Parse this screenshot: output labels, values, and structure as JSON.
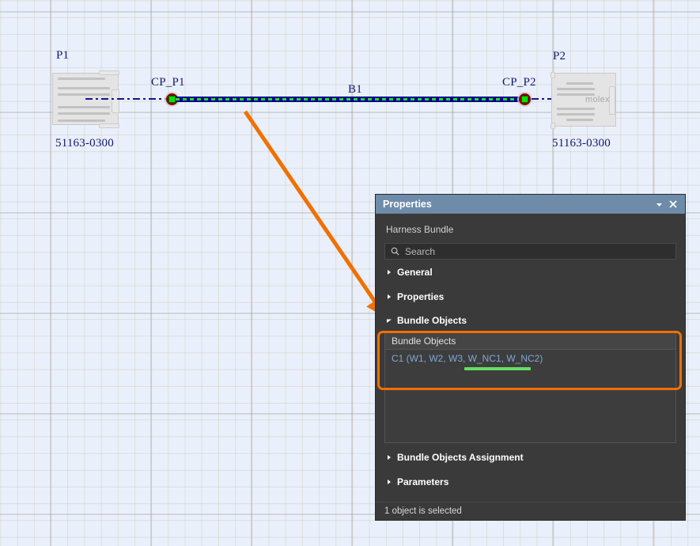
{
  "canvas": {
    "connectors": [
      {
        "id": "p1",
        "ref_label": "P1",
        "part_number": "51163-0300",
        "brand": "",
        "cp_label": "CP_P1"
      },
      {
        "id": "p2",
        "ref_label": "P2",
        "part_number": "51163-0300",
        "brand": "molex",
        "cp_label": "CP_P2"
      }
    ],
    "bundle": {
      "label": "B1",
      "core_color": "#00008f",
      "dash_color": "#1fe01f"
    },
    "node_colors": {
      "ring": "#8b0000",
      "square": "#00e400"
    },
    "annotation": {
      "type": "arrow",
      "color": "#f07000"
    }
  },
  "panel": {
    "title": "Properties",
    "subtitle": "Harness Bundle",
    "titlebar_buttons": [
      {
        "name": "menu-dropdown",
        "glyph": "triangle-down"
      },
      {
        "name": "close",
        "glyph": "x"
      }
    ],
    "search": {
      "icon": "search-icon",
      "placeholder": "Search",
      "value": ""
    },
    "sections": [
      {
        "key": "general",
        "label": "General",
        "expanded": false
      },
      {
        "key": "properties",
        "label": "Properties",
        "expanded": false
      },
      {
        "key": "bundle_objects",
        "label": "Bundle Objects",
        "expanded": true,
        "highlighted": true
      },
      {
        "key": "bundle_objects_assignment",
        "label": "Bundle Objects Assignment",
        "expanded": false
      },
      {
        "key": "parameters",
        "label": "Parameters",
        "expanded": false
      }
    ],
    "bundle_objects": {
      "column_header": "Bundle Objects",
      "rows": [
        {
          "label": "C1 (W1, W2, W3, W_NC1, W_NC2)",
          "color": "#7fa8d4",
          "underlined": true
        }
      ]
    },
    "status": "1 object is selected",
    "highlight_color": "#f07000",
    "titlebar_color": "#6e8caa"
  }
}
